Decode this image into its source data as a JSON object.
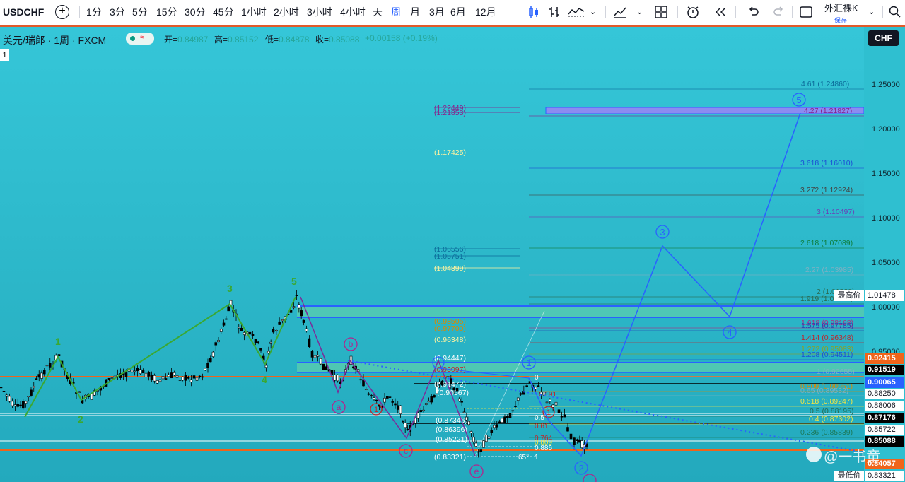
{
  "toolbar": {
    "symbol": "USDCHF",
    "add": "+",
    "intervals": [
      "1分",
      "3分",
      "5分",
      "15分",
      "30分",
      "45分",
      "1小时",
      "2小时",
      "3小时",
      "4小时",
      "天",
      "周",
      "月",
      "3月",
      "6月",
      "12月"
    ],
    "active_interval": "周",
    "template_name": "外汇裸K",
    "template_status": "保存",
    "accent": "#2962ff"
  },
  "legend": {
    "title": "美元/瑞郎 · 1周 · FXCM",
    "open_label": "开=",
    "open": "0.84987",
    "high_label": "高=",
    "high": "0.85152",
    "low_label": "低=",
    "low": "0.84878",
    "close_label": "收=",
    "close": "0.85088",
    "change": "+0.00158 (+0.19%)",
    "pane_index": "1",
    "pill": "≈"
  },
  "currency": "CHF",
  "price_ticks": [
    "1.25000",
    "1.20000",
    "1.15000",
    "1.10000",
    "1.05000",
    "1.00000",
    "0.95000"
  ],
  "price_labels": [
    {
      "text": "1.01478",
      "bg": "#ffffff",
      "fg": "#131722",
      "tag": "最高价"
    },
    {
      "text": "0.92415",
      "bg": "#f0641a",
      "fg": "#ffffff"
    },
    {
      "text": "0.91519",
      "bg": "#000000",
      "fg": "#ffffff"
    },
    {
      "text": "0.90065",
      "bg": "#2962ff",
      "fg": "#ffffff"
    },
    {
      "text": "0.88250",
      "bg": "#ffffff",
      "fg": "#131722"
    },
    {
      "text": "0.88006",
      "bg": "#ffffff",
      "fg": "#131722"
    },
    {
      "text": "0.87176",
      "bg": "#000000",
      "fg": "#ffffff"
    },
    {
      "text": "0.85722",
      "bg": "#ffffff",
      "fg": "#131722"
    },
    {
      "text": "0.85088",
      "bg": "#000000",
      "fg": "#ffffff"
    },
    {
      "text": "0.84057",
      "bg": "#f0641a",
      "fg": "#ffffff"
    },
    {
      "text": "0.83321",
      "bg": "#ffffff",
      "fg": "#131722",
      "tag": "最低价"
    }
  ],
  "fib_right": [
    {
      "text": "4.61 (1.24860)",
      "color": "#0c6b9a"
    },
    {
      "text": "4.27 (1.21827)",
      "color": "#8a1f8a"
    },
    {
      "text": "3.618 (1.16010)",
      "color": "#1c4fd6"
    },
    {
      "text": "3.272 (1.12924)",
      "color": "#444444"
    },
    {
      "text": "3 (1.10497)",
      "color": "#6a3fb8"
    },
    {
      "text": "2.618 (1.07089)",
      "color": "#0e7d3a"
    },
    {
      "text": "2.27 (1.03985)",
      "color": "#7fb0c2"
    },
    {
      "text": "2 (1.01538)",
      "color": "#2a6a50"
    },
    {
      "text": "1.919 (1.00835)",
      "color": "#2a6a50"
    },
    {
      "text": "1.618 (0.98168)",
      "color": "#b02a80"
    },
    {
      "text": "1.575 (0.97785)",
      "color": "#2a40b0"
    },
    {
      "text": "1.414 (0.96348)",
      "color": "#c0232a"
    },
    {
      "text": "1.272 (0.95083)",
      "color": "#8fa020"
    },
    {
      "text": "1.208 (0.94511)",
      "color": "#1c4fd6"
    },
    {
      "text": "1 (0.92655)",
      "color": "#7fb0c2"
    },
    {
      "text": "0.809 (0.90951)",
      "color": "#d98a00"
    },
    {
      "text": "0.65 (0.89532)",
      "color": "#7fb0c2"
    },
    {
      "text": "0.618 (0.89247)",
      "color": "#f5e642"
    },
    {
      "text": "0.5 (0.88195)",
      "color": "#2a6a50"
    },
    {
      "text": "0.4 (0.87302)",
      "color": "#f5e642"
    },
    {
      "text": "0.236 (0.85839)",
      "color": "#1c7a5a"
    }
  ],
  "fib_mid": [
    {
      "text": "(1.22449)",
      "color": "#8a1f8a"
    },
    {
      "text": "(1.21853)",
      "color": "#8a1f8a"
    },
    {
      "text": "(1.17425)",
      "color": "#fff3a0"
    },
    {
      "text": "(1.06556)",
      "color": "#0c6b9a"
    },
    {
      "text": "(1.05751)",
      "color": "#0c6b9a"
    },
    {
      "text": "(1.04399)",
      "color": "#fff3a0"
    },
    {
      "text": "(0.98505)",
      "color": "#d98a00"
    },
    {
      "text": "(0.97700)",
      "color": "#d98a00"
    },
    {
      "text": "(0.96348)",
      "color": "#fff3a0"
    },
    {
      "text": "(0.94447)",
      "color": "#ffffff"
    },
    {
      "text": "(0.93097)",
      "color": "#c0232a"
    },
    {
      "text": "(0.91472)",
      "color": "#ffffff"
    },
    {
      "text": "(0.90567)",
      "color": "#ffffff"
    },
    {
      "text": "(0.87346)",
      "color": "#ffffff"
    },
    {
      "text": "(0.86396)",
      "color": "#ffffff"
    },
    {
      "text": "(0.85221)",
      "color": "#ffffff"
    },
    {
      "text": "(0.83321)",
      "color": "#ffffff"
    }
  ],
  "fib_small": [
    {
      "text": "0",
      "color": "#ffffff"
    },
    {
      "text": "0.191",
      "color": "#c0232a"
    },
    {
      "text": "0.5",
      "color": "#ffffff"
    },
    {
      "text": "0.61",
      "color": "#c0232a"
    },
    {
      "text": "0.764",
      "color": "#c0232a"
    },
    {
      "text": "0.809",
      "color": "#f5e642"
    },
    {
      "text": "0.886",
      "color": "#ffffff"
    },
    {
      "text": "65°",
      "color": "#ffffff"
    },
    {
      "text": "1",
      "color": "#ffffff"
    }
  ],
  "wave_labels": {
    "green": [
      "1",
      "2",
      "3",
      "4",
      "5"
    ],
    "purple_circ": [
      "a",
      "b",
      "c",
      "e"
    ],
    "blue_circ": [
      "1",
      "2",
      "3",
      "4",
      "5"
    ],
    "red_circ": [
      "1",
      "1"
    ]
  },
  "watermark": "@一书童"
}
